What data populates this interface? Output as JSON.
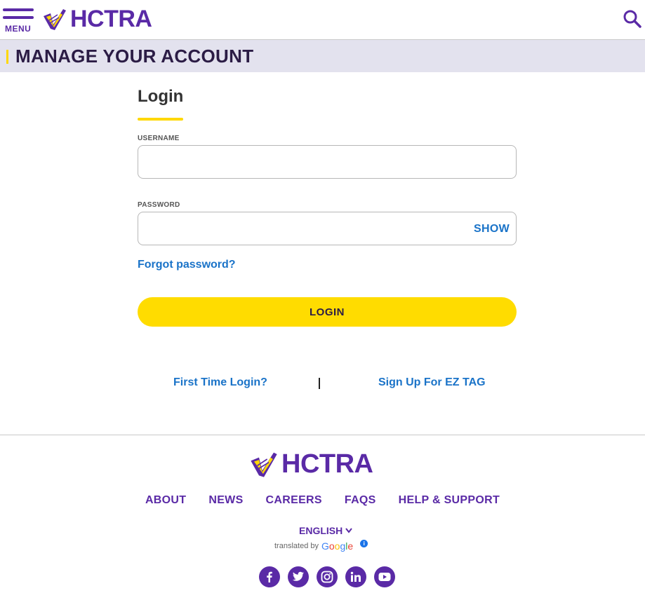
{
  "header": {
    "menu_label": "MENU",
    "logo_text": "HCTRA",
    "search_icon": "search-icon"
  },
  "banner": {
    "title": "MANAGE YOUR ACCOUNT"
  },
  "login": {
    "title": "Login",
    "username_label": "USERNAME",
    "username_value": "",
    "password_label": "PASSWORD",
    "password_value": "",
    "show_label": "SHOW",
    "forgot_label": "Forgot password?",
    "login_button": "LOGIN",
    "first_time_label": "First Time Login?",
    "signup_label": "Sign Up For EZ TAG"
  },
  "footer": {
    "logo_text": "HCTRA",
    "nav": [
      "ABOUT",
      "NEWS",
      "CAREERS",
      "FAQS",
      "HELP & SUPPORT"
    ],
    "language": "ENGLISH",
    "translated_by": "translated by",
    "google": "Google",
    "socials": [
      "facebook-icon",
      "twitter-icon",
      "instagram-icon",
      "linkedin-icon",
      "youtube-icon"
    ]
  },
  "colors": {
    "brand_purple": "#5a2aa6",
    "accent_yellow": "#ffdc00",
    "link_blue": "#1a73c8",
    "banner_bg": "#e3e2ee"
  }
}
